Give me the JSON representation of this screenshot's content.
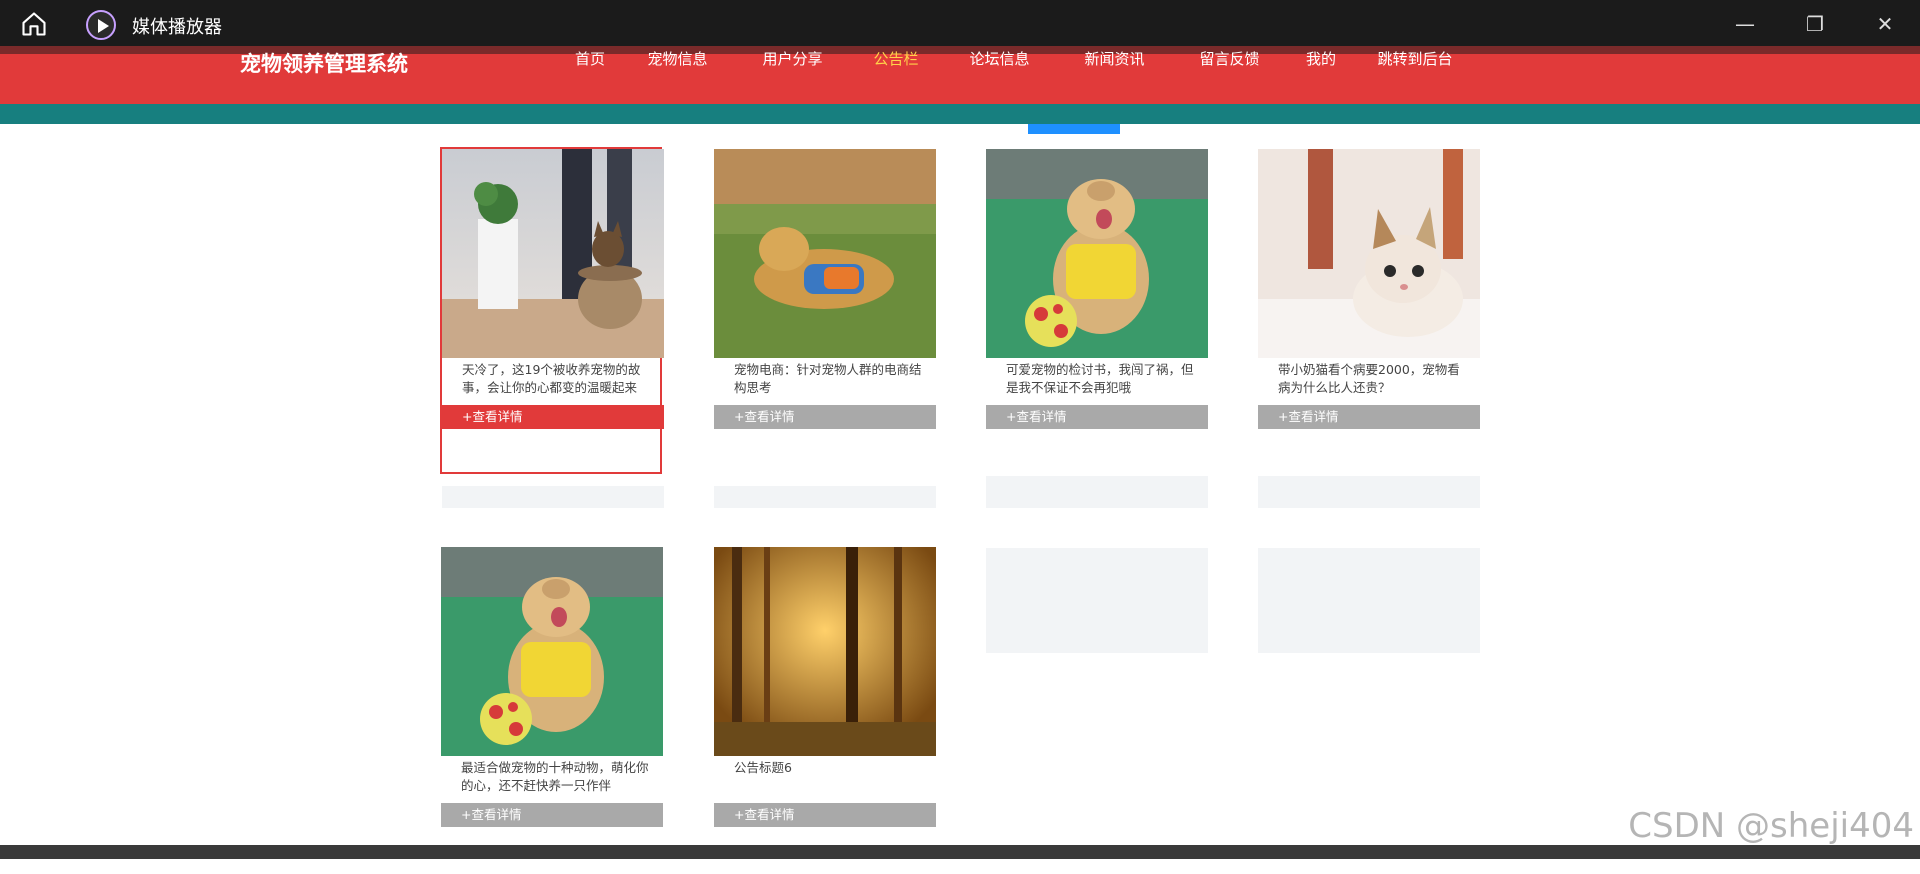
{
  "player": {
    "title": "媒体播放器",
    "controls": [
      "—",
      "❐",
      "✕"
    ]
  },
  "site": {
    "brand": "宠物领养管理系统",
    "nav": [
      {
        "label": "首页",
        "active": false
      },
      {
        "label": "宠物信息",
        "active": false
      },
      {
        "label": "用户分享",
        "active": false
      },
      {
        "label": "公告栏",
        "active": true
      },
      {
        "label": "论坛信息",
        "active": false
      },
      {
        "label": "新闻资讯",
        "active": false
      },
      {
        "label": "留言反馈",
        "active": false
      },
      {
        "label": "我的",
        "active": false
      },
      {
        "label": "跳转到后台",
        "active": false
      }
    ],
    "colors": {
      "header": "#e13a3a",
      "teal": "#177f7f",
      "active_nav": "#ffd24a"
    }
  },
  "cards": [
    {
      "caption": "天冷了，这19个被收养宠物的故事，会让你的心都变的温暖起来",
      "button": "+查看详情",
      "image": "cat-in-cup",
      "active": true
    },
    {
      "caption": "宠物电商：针对宠物人群的电商结构思考",
      "button": "+查看详情",
      "image": "golden-retriever-grass",
      "active": false
    },
    {
      "caption": "可爱宠物的检讨书，我闯了祸，但是我不保证不会再犯哦",
      "button": "+查看详情",
      "image": "dog-with-ball",
      "active": false
    },
    {
      "caption": "带小奶猫看个病要2000，宠物看病为什么比人还贵？",
      "button": "+查看详情",
      "image": "kitten-on-rug",
      "active": false
    },
    {
      "caption": "最适合做宠物的十种动物，萌化你的心，还不赶快养一只作伴",
      "button": "+查看详情",
      "image": "dog-with-ball",
      "active": false
    },
    {
      "caption": "公告标题6",
      "button": "+查看详情",
      "image": "forest-sunset",
      "active": false
    }
  ],
  "watermark": "CSDN @sheji404"
}
